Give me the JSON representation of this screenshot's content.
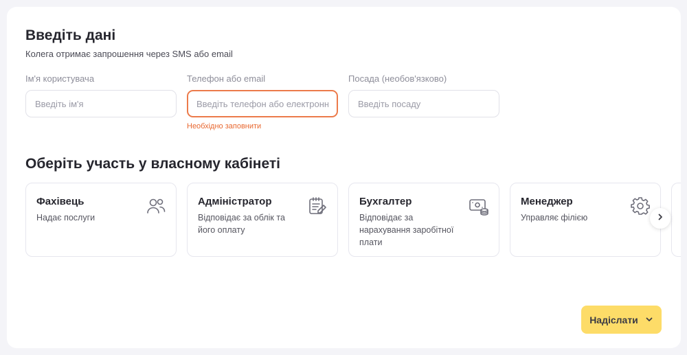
{
  "form": {
    "title": "Введіть дані",
    "subtitle": "Колега отримає запрошення через SMS або email",
    "fields": [
      {
        "label": "Ім'я користувача",
        "placeholder": "Введіть ім'я",
        "value": ""
      },
      {
        "label": "Телефон або email",
        "placeholder": "Введіть телефон або електронну пошту",
        "value": "",
        "error": "Необхідно заповнити"
      },
      {
        "label": "Посада (необов'язково)",
        "placeholder": "Введіть посаду",
        "value": ""
      }
    ]
  },
  "roles": {
    "title": "Оберіть участь у власному кабінеті",
    "items": [
      {
        "name": "Фахівець",
        "description": "Надає послуги",
        "icon": "users-icon"
      },
      {
        "name": "Адміністратор",
        "description": "Відповідає за облік та його оплату",
        "icon": "clipboard-edit-icon"
      },
      {
        "name": "Бухгалтер",
        "description": "Відповідає за нарахування заробітної плати",
        "icon": "money-coins-icon"
      },
      {
        "name": "Менеджер",
        "description": "Управляє філією",
        "icon": "gear-icon"
      }
    ],
    "next_icon": "chevron-right-icon"
  },
  "actions": {
    "submit_label": "Надіслати",
    "submit_icon": "chevron-down-icon"
  },
  "colors": {
    "accent": "#fddc68",
    "error": "#e8672f",
    "error_border": "#ec7a4a",
    "card_border": "#e6e6ee",
    "background": "#f4f4f8"
  }
}
